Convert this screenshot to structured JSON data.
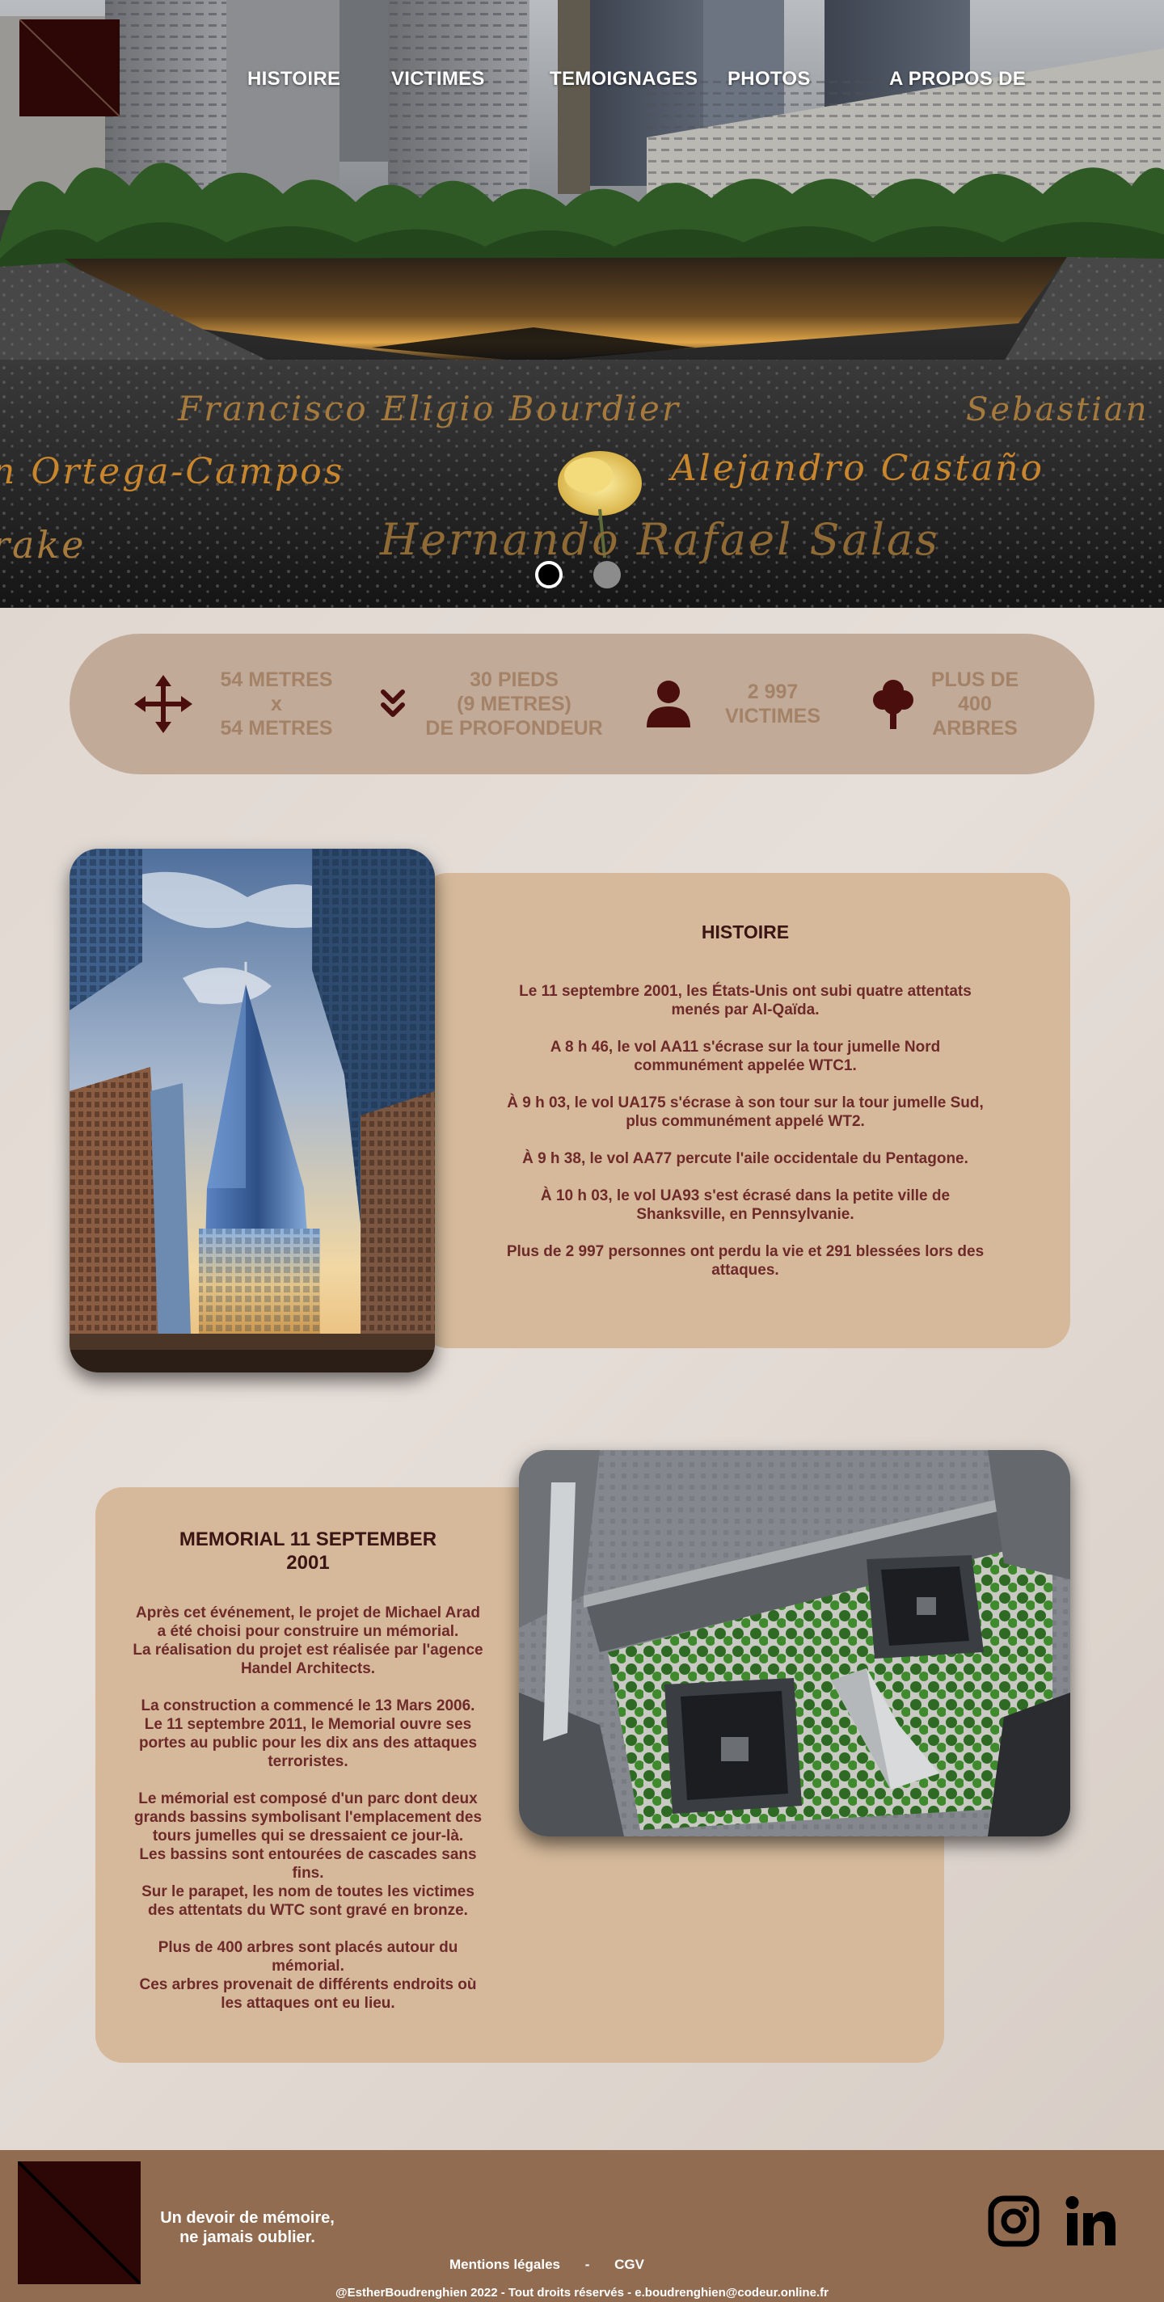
{
  "nav": {
    "items": [
      {
        "label": "HISTOIRE"
      },
      {
        "label": "VICTIMES"
      },
      {
        "label": "TEMOIGNAGES"
      },
      {
        "label": "PHOTOS"
      },
      {
        "label": "A PROPOS DE"
      }
    ]
  },
  "hero": {
    "engraved_names": [
      "Francisco Eligio Bourdier",
      "Sebastian",
      "n Ortega-Campos",
      "Alejandro Castaño",
      "rake",
      "Hernando Rafael Salas"
    ],
    "carousel": {
      "slides": 2,
      "active_index": 0
    }
  },
  "stats": {
    "items": [
      {
        "icon": "move-arrows-icon",
        "lines": [
          "54 METRES",
          "x",
          "54 METRES"
        ]
      },
      {
        "icon": "double-chevron-down-icon",
        "lines": [
          "30 PIEDS",
          "(9 METRES)",
          "DE PROFONDEUR"
        ]
      },
      {
        "icon": "person-icon",
        "lines": [
          "2 997",
          "VICTIMES"
        ]
      },
      {
        "icon": "tree-icon",
        "lines": [
          "PLUS DE",
          "400",
          "ARBRES"
        ]
      }
    ]
  },
  "histoire": {
    "title": "HISTOIRE",
    "paragraphs": [
      [
        "Le 11 septembre 2001, les États-Unis ont subi quatre attentats",
        "menés par Al-Qaïda."
      ],
      [
        "A 8 h 46, le vol AA11 s'écrase sur la tour jumelle Nord",
        "communément appelée WTC1."
      ],
      [
        "À 9 h 03, le vol UA175 s'écrase à son tour sur la tour jumelle Sud,",
        "plus communément appelé WT2."
      ],
      [
        "À 9 h 38, le vol AA77 percute l'aile occidentale du Pentagone."
      ],
      [
        "À 10 h 03, le vol UA93 s'est écrasé dans la petite ville de",
        "Shanksville, en Pennsylvanie."
      ],
      [
        "Plus de 2 997 personnes ont perdu la vie et 291 blessées lors des",
        "attaques."
      ]
    ]
  },
  "memorial": {
    "title_lines": [
      "MEMORIAL 11 SEPTEMBER",
      "2001"
    ],
    "paragraphs": [
      [
        "Après cet événement, le projet de Michael Arad",
        "a été choisi pour construire un mémorial.",
        "La réalisation du projet est réalisée par l'agence",
        "Handel Architects."
      ],
      [
        "La construction a commencé le 13 Mars 2006.",
        "Le 11 septembre 2011, le Memorial ouvre ses",
        "portes au public pour les dix ans des attaques",
        "terroristes."
      ],
      [
        "Le mémorial est composé d'un parc dont deux",
        "grands bassins symbolisant l'emplacement des",
        "tours jumelles qui se dressaient ce jour-là.",
        "Les bassins sont entourées de cascades sans",
        "fins.",
        "Sur le parapet, les nom de toutes les victimes",
        "des attentats du WTC sont gravé en bronze."
      ],
      [
        "Plus de 400 arbres sont placés autour du",
        "mémorial.",
        "Ces arbres provenait de différents endroits où",
        "les attaques ont eu lieu."
      ]
    ]
  },
  "footer": {
    "tagline_lines": [
      "Un devoir de mémoire,",
      "ne jamais oublier."
    ],
    "links": [
      "Mentions légales",
      "CGV"
    ],
    "separator": "-",
    "copyright": "@EstherBoudrenghien 2022 - Tout droits réservés - e.boudrenghien@codeur.online.fr",
    "social": [
      "instagram-icon",
      "linkedin-icon"
    ]
  },
  "colors": {
    "logo": "#2d0705",
    "stats_bg": "#c1ab98",
    "stats_text": "#a38268",
    "stats_icon": "#4a0f0c",
    "card_bg": "#d5b99a",
    "card_title": "#3b1414",
    "card_text": "#6e2a2a",
    "footer_bg": "#926c51"
  }
}
